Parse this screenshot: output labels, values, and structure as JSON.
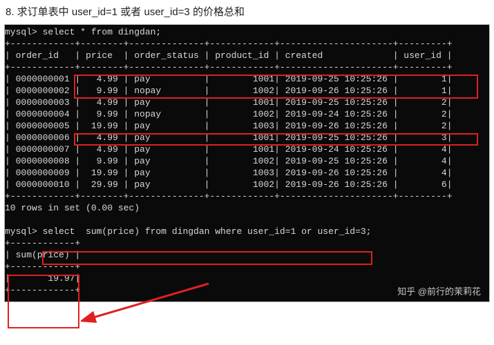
{
  "question": "8. 求订单表中 user_id=1 或者 user_id=3 的价格总和",
  "prompt1": "mysql> select * from dingdan;",
  "headers": {
    "order_id": "order_id",
    "price": "price",
    "order_status": "order_status",
    "product_id": "product_id",
    "created": "created",
    "user_id": "user_id"
  },
  "rows": [
    {
      "order_id": "0000000001",
      "price": "4.99",
      "status": "pay",
      "product": "1001",
      "created": "2019-09-25 10:25:26",
      "user": "1"
    },
    {
      "order_id": "0000000002",
      "price": "9.99",
      "status": "nopay",
      "product": "1002",
      "created": "2019-09-26 10:25:26",
      "user": "1"
    },
    {
      "order_id": "0000000003",
      "price": "4.99",
      "status": "pay",
      "product": "1001",
      "created": "2019-09-25 10:25:26",
      "user": "2"
    },
    {
      "order_id": "0000000004",
      "price": "9.99",
      "status": "nopay",
      "product": "1002",
      "created": "2019-09-24 10:25:26",
      "user": "2"
    },
    {
      "order_id": "0000000005",
      "price": "19.99",
      "status": "pay",
      "product": "1003",
      "created": "2019-09-26 10:25:26",
      "user": "2"
    },
    {
      "order_id": "0000000006",
      "price": "4.99",
      "status": "pay",
      "product": "1001",
      "created": "2019-09-25 10:25:26",
      "user": "3"
    },
    {
      "order_id": "0000000007",
      "price": "4.99",
      "status": "pay",
      "product": "1001",
      "created": "2019-09-24 10:25:26",
      "user": "4"
    },
    {
      "order_id": "0000000008",
      "price": "9.99",
      "status": "pay",
      "product": "1002",
      "created": "2019-09-25 10:25:26",
      "user": "4"
    },
    {
      "order_id": "0000000009",
      "price": "19.99",
      "status": "pay",
      "product": "1003",
      "created": "2019-09-26 10:25:26",
      "user": "4"
    },
    {
      "order_id": "0000000010",
      "price": "29.99",
      "status": "pay",
      "product": "1002",
      "created": "2019-09-26 10:25:26",
      "user": "6"
    }
  ],
  "rows_summary": "10 rows in set (0.00 sec)",
  "prompt2": "mysql> select  sum(price) from dingdan where user_id=1 or user_id=3;",
  "result_header": "sum(price)",
  "result_value": "19.97",
  "watermark": "知乎 @前行的茉莉花"
}
